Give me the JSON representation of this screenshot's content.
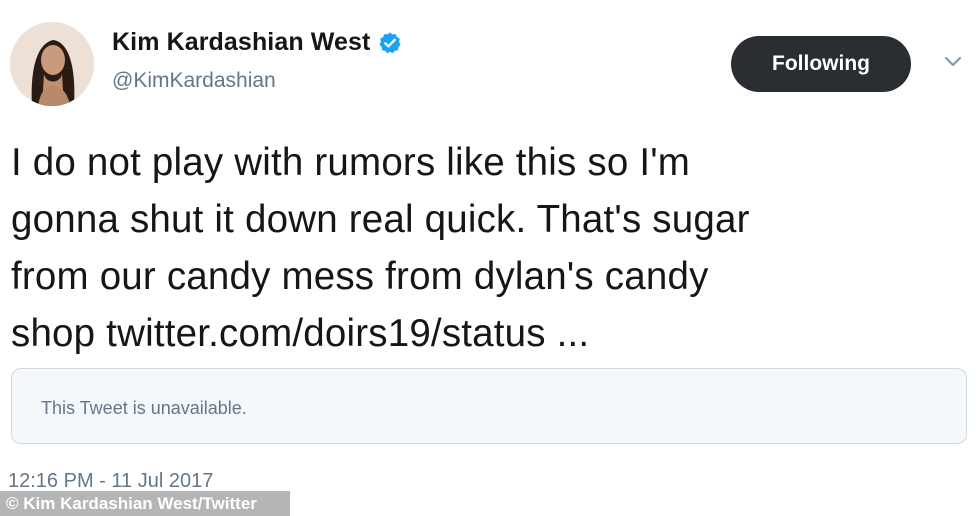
{
  "author": {
    "display_name": "Kim Kardashian West",
    "handle": "@KimKardashian",
    "verified_icon": "verified-badge-icon",
    "verified_color": "#1da1f2"
  },
  "actions": {
    "follow_label": "Following",
    "more_icon": "chevron-down-icon"
  },
  "tweet": {
    "lines": [
      "I do not play with rumors like this so I'm",
      "gonna shut it down real quick. That's sugar",
      "from our candy mess from dylan's candy",
      "shop twitter.com/doirs19/status ..."
    ],
    "quoted_unavailable": "This Tweet is unavailable.",
    "timestamp": "12:16 PM - 11 Jul 2017"
  },
  "credit": "© Kim Kardashian West/Twitter",
  "colors": {
    "text": "#14171a",
    "secondary": "#657786",
    "button_bg": "#2a2d31",
    "card_bg": "#f5f8fa"
  }
}
